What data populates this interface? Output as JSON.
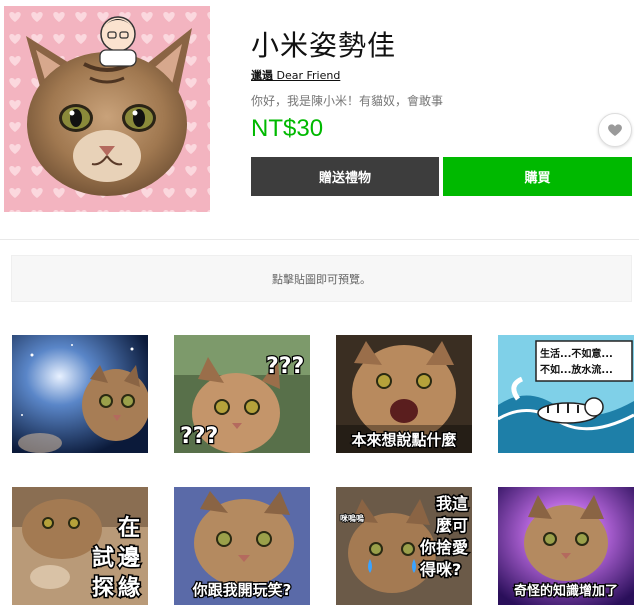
{
  "product": {
    "title": "小米姿勢佳",
    "author_icon": "邋遢",
    "author": "Dear Friend",
    "description": "你好，我是陳小米！有貓奴，會敢事",
    "price": "NT$30"
  },
  "actions": {
    "gift_label": "贈送禮物",
    "buy_label": "購買",
    "favorite_icon": "heart-icon"
  },
  "preview_hint": "點擊貼圖即可預覽。",
  "stickers": [
    {
      "caption": ""
    },
    {
      "caption": "??? / ???"
    },
    {
      "caption": "本來想說點什麼"
    },
    {
      "caption": "生活...不如意... 不如...放水流..."
    },
    {
      "caption": "在試邊探緣"
    },
    {
      "caption": "你跟我開玩笑?"
    },
    {
      "caption": "咪嗚嗚 我這麼可愛你捨得咪?"
    },
    {
      "caption": "奇怪的知識增加了"
    }
  ],
  "sticker_text": {
    "s2_q1": "???",
    "s2_q2": "???",
    "s3": "本來想說點什麼",
    "s4_l1": "生活...不如意...",
    "s4_l2": "不如...放水流...",
    "s5_a": "在",
    "s5_b1": "試",
    "s5_b2": "邊",
    "s5_c1": "探",
    "s5_c2": "緣",
    "s6": "你跟我開玩笑?",
    "s7_small": "咪嗚嗚",
    "s7_l1": "我這",
    "s7_l2": "麼可",
    "s7_l3": "你捨",
    "s7_l4": "愛",
    "s7_l5": "得咪?",
    "s8": "奇怪的知識增加了"
  },
  "colors": {
    "line_green": "#00b900",
    "dark_button": "#3d3d3d",
    "hero_bg": "#f4b9c3"
  }
}
